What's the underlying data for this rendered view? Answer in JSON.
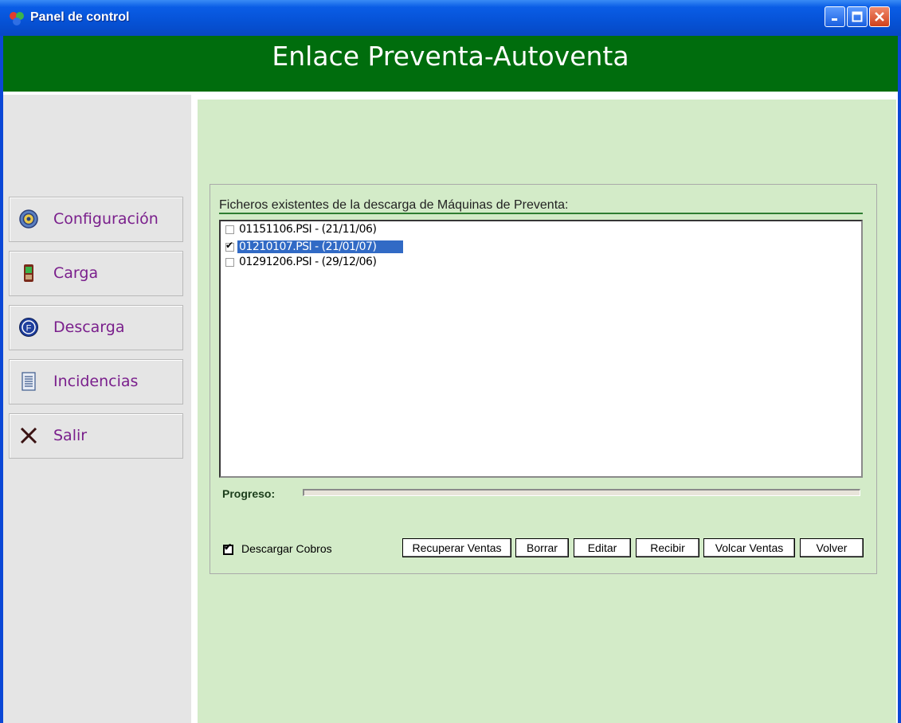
{
  "window": {
    "title": "Panel de control",
    "controls": {
      "minimize": "minimize",
      "maximize": "maximize",
      "close": "close"
    }
  },
  "header": {
    "title": "Enlace Preventa-Autoventa"
  },
  "sidebar": {
    "items": [
      {
        "label": "Configuración",
        "icon": "gear-icon"
      },
      {
        "label": "Carga",
        "icon": "handheld-device-icon"
      },
      {
        "label": "Descarga",
        "icon": "download-circle-icon"
      },
      {
        "label": "Incidencias",
        "icon": "document-icon"
      },
      {
        "label": "Salir",
        "icon": "exit-x-icon"
      }
    ]
  },
  "main": {
    "group_label": "Ficheros existentes de la descarga de Máquinas de Preventa:",
    "files": [
      {
        "name": "01151106.PSI - (21/11/06)",
        "checked": false,
        "selected": false
      },
      {
        "name": "01210107.PSI - (21/01/07)",
        "checked": true,
        "selected": true
      },
      {
        "name": "01291206.PSI - (29/12/06)",
        "checked": false,
        "selected": false
      }
    ],
    "progress": {
      "label": "Progreso:",
      "value": 0
    },
    "descargar_cobros": {
      "label": "Descargar Cobros",
      "checked": true
    },
    "buttons": {
      "recuperar": "Recuperar Ventas",
      "borrar": "Borrar",
      "editar": "Editar",
      "recibir": "Recibir",
      "volcar": "Volcar Ventas",
      "volver": "Volver"
    }
  },
  "colors": {
    "titlebar": "#0652d6",
    "header": "#006d0d",
    "main_bg": "#d3ebc8",
    "sidebar_bg": "#e5e5e5",
    "selection": "#316ac5",
    "nav_label": "#7a1f8c"
  }
}
